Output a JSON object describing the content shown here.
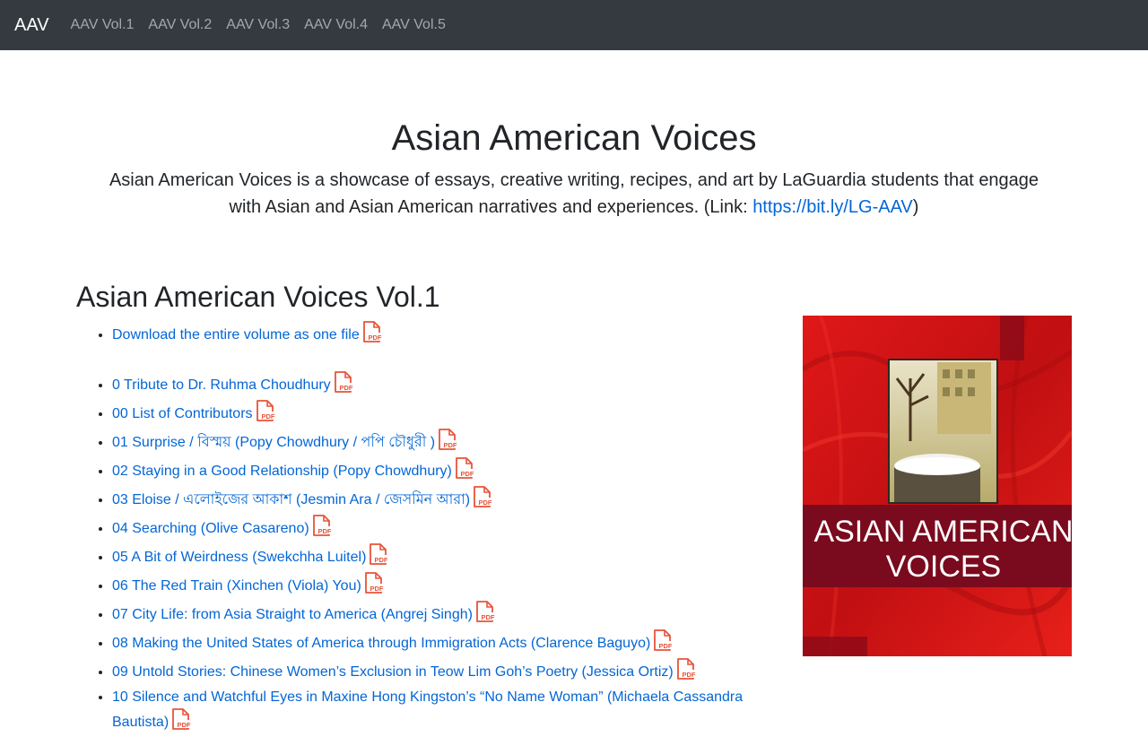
{
  "nav": {
    "brand": "AAV",
    "links": [
      "AAV Vol.1",
      "AAV Vol.2",
      "AAV Vol.3",
      "AAV Vol.4",
      "AAV Vol.5"
    ]
  },
  "hero": {
    "title": "Asian American Voices",
    "description": "Asian American Voices is a showcase of essays, creative writing, recipes, and art by LaGuardia students that engage with Asian and Asian American narratives and experiences. (Link: ",
    "link_text": "https://bit.ly/LG-AAV",
    "description_end": ")"
  },
  "volume": {
    "title": "Asian American Voices Vol.1",
    "download_label": "Download the entire volume as one file",
    "items": [
      "0 Tribute to Dr. Ruhma Choudhury",
      "00 List of Contributors",
      "01 Surprise / বিস্ময় (Popy Chowdhury / পপি চৌধুরী )",
      "02 Staying in a Good Relationship (Popy Chowdhury)",
      "03 Eloise / এলোইজের আকাশ (Jesmin Ara / জেসমিন আরা)",
      "04 Searching (Olive Casareno)",
      "05 A Bit of Weirdness (Swekchha Luitel)",
      "06 The Red Train (Xinchen (Viola) You)",
      "07 City Life: from Asia Straight to America (Angrej Singh)",
      "08 Making the United States of America through Immigration Acts (Clarence Baguyo)",
      "09 Untold Stories: Chinese Women’s Exclusion in Teow Lim Goh’s Poetry (Jessica Ortiz)",
      "10 Silence and Watchful Eyes in Maxine Hong Kingston’s “No Name Woman” (Michaela Cassandra Bautista)"
    ],
    "pdf_icon_text": "PDF",
    "cover": {
      "line1": "ASIAN AMERICAN",
      "line2": "VOICES"
    }
  },
  "colors": {
    "navbar": "#343a40",
    "link": "#0366d6",
    "pdf_icon": "#e8533a",
    "cover_red": "#d41414",
    "cover_band": "#7a0a1e"
  }
}
